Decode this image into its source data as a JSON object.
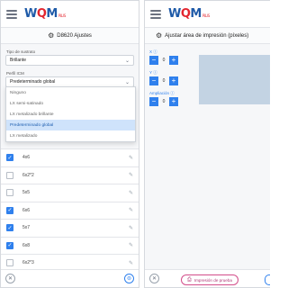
{
  "left": {
    "logo": {
      "w": "W",
      "q": "Q",
      "m": "M",
      "sub": "PLUS"
    },
    "title": "D8620 Ajustes",
    "source_label": "Tipo de sustrato",
    "source_value": "Brillante",
    "profile_label": "Perfil ICM",
    "profile_value": "Predeterminado global",
    "dropdown_options": [
      {
        "label": "Ninguno",
        "selected": false
      },
      {
        "label": "LX semi-satinado",
        "selected": false
      },
      {
        "label": "LX metalizado brillante",
        "selected": false
      },
      {
        "label": "Predeterminado global",
        "selected": true
      },
      {
        "label": "LX metalizado",
        "selected": false
      }
    ],
    "rows": [
      {
        "label": "4x6",
        "checked": true
      },
      {
        "label": "6x2*2",
        "checked": false
      },
      {
        "label": "5x5",
        "checked": false
      },
      {
        "label": "6x6",
        "checked": true
      },
      {
        "label": "5x7",
        "checked": true
      },
      {
        "label": "6x8",
        "checked": true
      },
      {
        "label": "6x2*3",
        "checked": false
      }
    ]
  },
  "right": {
    "logo": {
      "w": "W",
      "q": "Q",
      "m": "M",
      "sub": "PLUS"
    },
    "title": "Ajustar área de impresión (píxeles)",
    "x_label": "X",
    "x_value": "0",
    "y_label": "Y",
    "y_value": "0",
    "scale_label": "Ampliación",
    "scale_value": "0",
    "print_test_label": "Impresión de prueba"
  },
  "colors": {
    "accent": "#2f80ed",
    "brand_blue": "#1e5aa8",
    "brand_red": "#e3262f",
    "preview": "#c3d3e3"
  }
}
